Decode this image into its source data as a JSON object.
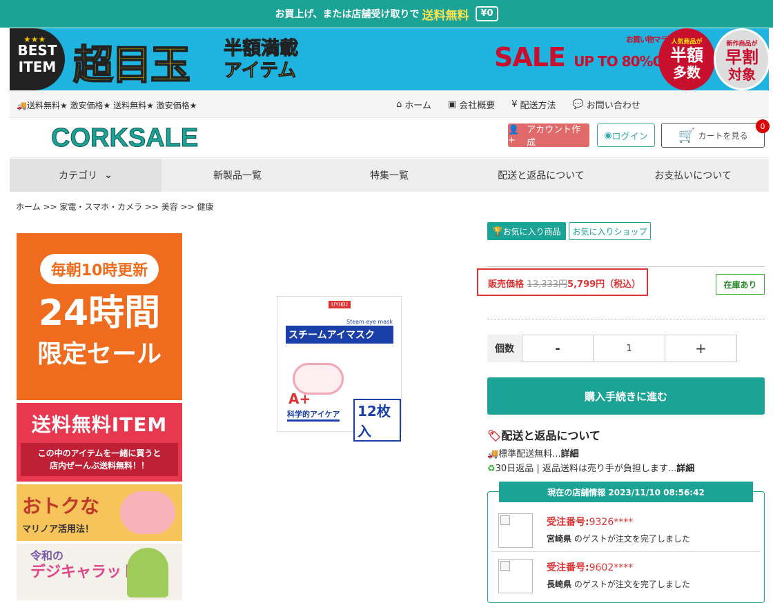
{
  "topbar": {
    "text": "お買上げ、または店舗受け取りで",
    "highlight": "送料無料",
    "truck": "¥0"
  },
  "banner": {
    "best_line1": "BEST",
    "best_line2": "ITEM",
    "headline": "超目玉",
    "subline1": "半額満載",
    "subline2": "アイテム",
    "sale": "SALE",
    "upto": "UP TO 80%OFF",
    "marathon": "お買い物マラソン",
    "circle1_small": "人気商品が",
    "circle1_big": "半額",
    "circle1_mid": "多数",
    "circle2_small": "新作商品が",
    "circle2_big": "早割",
    "circle2_mid": "対象"
  },
  "utilbar": {
    "marquee": "🚚送料無料★ 激安価格★ 送料無料★ 激安価格★",
    "links": [
      {
        "icon": "home-icon",
        "glyph": "⌂",
        "label": "ホーム"
      },
      {
        "icon": "company-icon",
        "glyph": "▣",
        "label": "会社概要"
      },
      {
        "icon": "yen-icon",
        "glyph": "¥",
        "label": "配送方法"
      },
      {
        "icon": "chat-icon",
        "glyph": "💬",
        "label": "お問い合わせ"
      }
    ]
  },
  "brand": {
    "logo": "CORKSALE",
    "account_button": "アカウント作成",
    "login_button": "ログイン",
    "cart_button": "カートを見る",
    "cart_count": "0"
  },
  "nav": {
    "category": "カテゴリ",
    "items": [
      "新製品一覧",
      "特集一覧",
      "配送と返品について",
      "お支払いについて"
    ]
  },
  "breadcrumb": "ホーム >> 家電・スマホ・カメラ >> 美容 >> 健康",
  "sidebar": {
    "s1_pill": "毎朝10時更新",
    "s1_big": "24時間",
    "s1_lim": "限定セール",
    "s2_title": "送料無料ITEM",
    "s2_desc1": "この中のアイテムを一緒に買うと",
    "s2_desc2": "店内ぜーんぶ送料無料！！",
    "s3_title": "おトクな",
    "s3_desc": "マリノア活用法！",
    "s4_line1": "令和の",
    "s4_line2": "デジキャラット"
  },
  "product_image": {
    "brand": "UYIKU",
    "en": "Steam eye mask",
    "title": "スチームアイマスク",
    "a_label": "A+",
    "count": "12枚入",
    "science": "科学的アイケア"
  },
  "favorites": {
    "item": "お気に入り商品",
    "shop": "お気に入りショップ"
  },
  "price": {
    "label": "販売価格",
    "original": "13,333円",
    "sale": "5,799円（税込）",
    "stock": "在庫あり"
  },
  "quantity": {
    "label": "個数",
    "minus": "-",
    "value": "1",
    "plus": "+"
  },
  "buy_button": "購入手続きに進む",
  "shipping": {
    "heading": "配送と返品について",
    "line1": "標準配送無料...",
    "line1_link": "詳細",
    "line2": "30日返品 | 返品送料は売り手が負担します...",
    "line2_link": "詳細"
  },
  "live": {
    "header": "現在の店舗情報 2023/11/10 08:56:42",
    "order_label": "受注番号:",
    "suffix": " のゲストが注文を完了しました",
    "orders": [
      {
        "number": "9326****",
        "pref": "宮崎県"
      },
      {
        "number": "9602****",
        "pref": "長崎県"
      }
    ]
  }
}
